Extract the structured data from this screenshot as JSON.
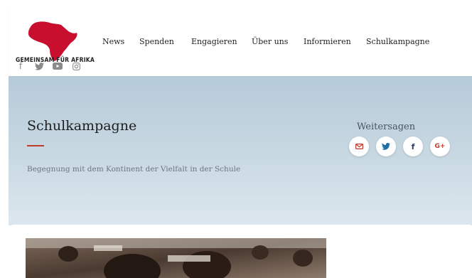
{
  "header": {
    "logo_text": "GEMEINSAM FÜR AFRIKA",
    "logo_icon": "africa-map-logo",
    "nav": [
      "News",
      "Spenden",
      "Engagieren",
      "Über uns",
      "Informieren",
      "Schulkampagne"
    ],
    "social_icons": [
      "facebook-icon",
      "twitter-icon",
      "youtube-icon",
      "instagram-icon"
    ]
  },
  "hero": {
    "title": "Schulkampagne",
    "subtitle": "Begegnung mit dem Kontinent der Vielfalt in der Schule",
    "share_label": "Weitersagen",
    "share_buttons": [
      "email-icon",
      "twitter-icon",
      "facebook-icon",
      "googleplus-icon"
    ],
    "share_glyphs": {
      "facebook": "f",
      "googleplus": "G+"
    }
  },
  "colors": {
    "accent_red": "#c0392b",
    "logo_red": "#c8102e",
    "twitter_blue": "#1da1f2",
    "facebook_blue": "#3b5998",
    "hero_gradient_top": "#b5cad8",
    "hero_gradient_bottom": "#dde7ee"
  },
  "content": {
    "image": "classroom-photo"
  }
}
